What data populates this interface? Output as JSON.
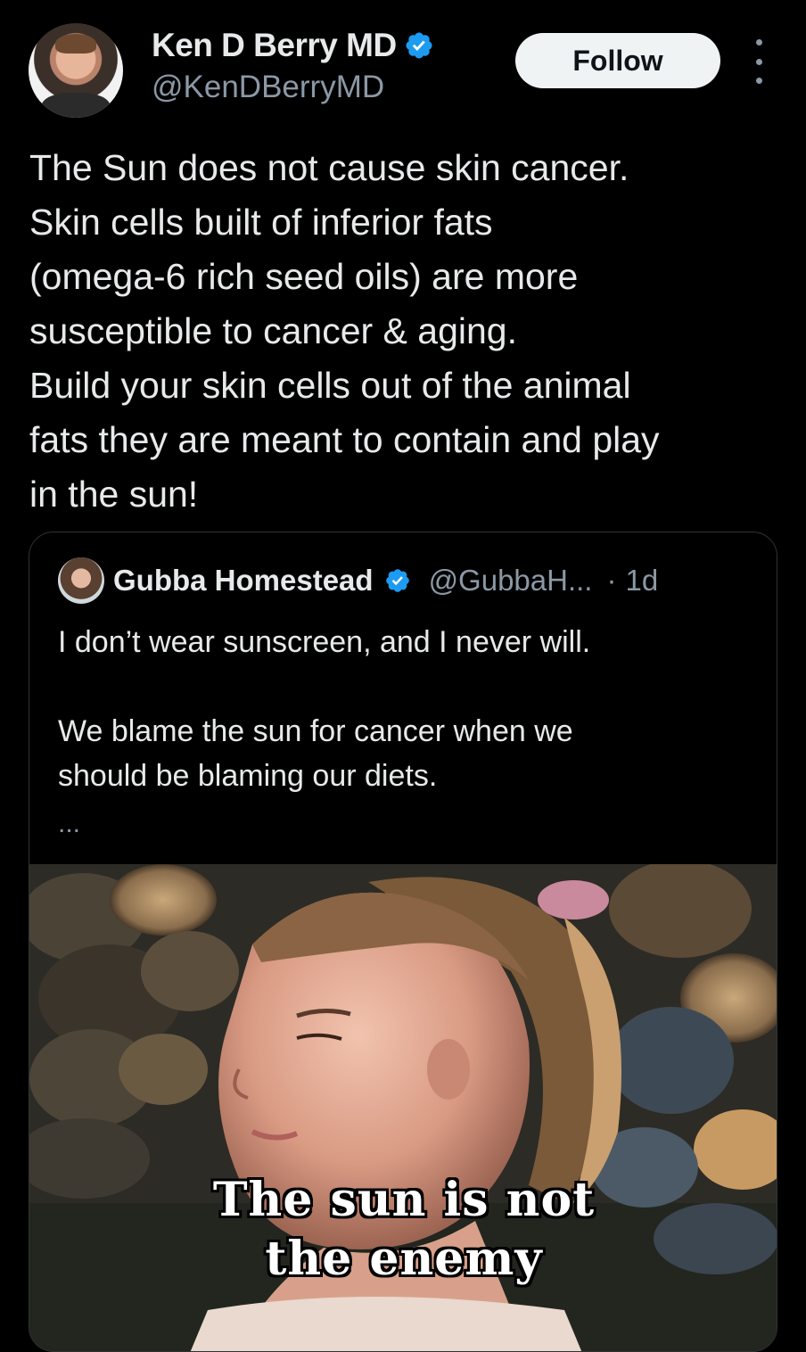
{
  "author": {
    "name": "Ken D Berry MD",
    "handle": "@KenDBerryMD",
    "verified": true,
    "badge_color": "#1d9bf0"
  },
  "actions": {
    "follow_label": "Follow",
    "more_icon": "more-vertical-icon"
  },
  "post": {
    "text": "The Sun does not cause skin cancer.\nSkin cells built of inferior fats\n(omega-6 rich seed oils) are more\nsusceptible to cancer & aging.\nBuild your skin cells out of the animal\nfats they are meant to contain and play\nin the sun!"
  },
  "quoted": {
    "name": "Gubba Homestead",
    "handle": "@GubbaH...",
    "separator": "·",
    "time": "1d",
    "verified": true,
    "text": "I don’t wear sunscreen, and I never will.\n\nWe blame the sun for cancer when we\nshould be blaming our diets.",
    "ellipsis": "...",
    "media": {
      "caption_line1": "The sun is not",
      "caption_line2": "the enemy"
    }
  }
}
